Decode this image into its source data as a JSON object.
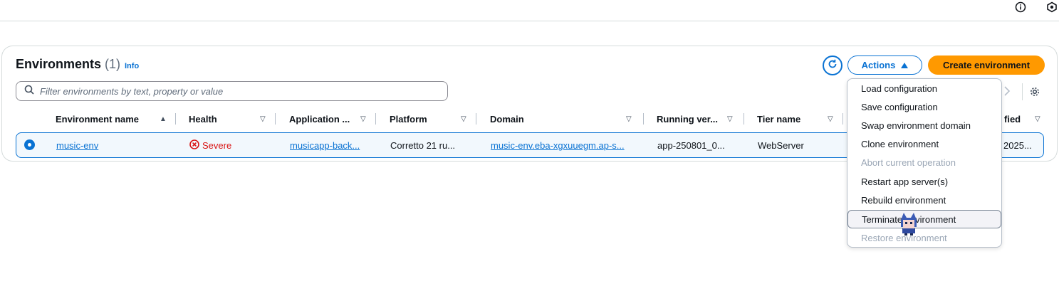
{
  "colors": {
    "accent": "#0972d3",
    "primary_button": "#ff9900",
    "severe": "#d91515",
    "selected_row_bg": "#f2f8fd",
    "disabled_text": "#9ba7b6"
  },
  "topbar": {
    "icons": [
      "info-circle-icon",
      "hexagon-icon"
    ]
  },
  "panel": {
    "title": "Environments",
    "count": "(1)",
    "info_link": "Info",
    "refresh_icon": "refresh-icon",
    "actions_label": "Actions",
    "create_label": "Create environment",
    "filter_placeholder": "Filter environments by text, property or value"
  },
  "table": {
    "columns": [
      {
        "label": "Environment name",
        "sort": "▲"
      },
      {
        "label": "Health",
        "sort": "▽"
      },
      {
        "label": "Application ...",
        "sort": "▽"
      },
      {
        "label": "Platform",
        "sort": "▽"
      },
      {
        "label": "Domain",
        "sort": "▽"
      },
      {
        "label": "Running ver...",
        "sort": "▽"
      },
      {
        "label": "Tier name",
        "sort": "▽"
      },
      {
        "label": "fied",
        "sort": "▽"
      }
    ],
    "rows": [
      {
        "selected": true,
        "environment_name": "music-env",
        "health": "Severe",
        "application": "musicapp-back...",
        "platform": "Corretto 21 ru...",
        "domain": "music-env.eba-xgxuuegm.ap-s...",
        "running_version": "app-250801_0...",
        "tier_name": "WebServer",
        "last_modified": "2025..."
      }
    ]
  },
  "actions_menu": {
    "items": [
      {
        "label": "Load configuration",
        "disabled": false
      },
      {
        "label": "Save configuration",
        "disabled": false
      },
      {
        "label": "Swap environment domain",
        "disabled": false
      },
      {
        "label": "Clone environment",
        "disabled": false
      },
      {
        "label": "Abort current operation",
        "disabled": true
      },
      {
        "label": "Restart app server(s)",
        "disabled": false
      },
      {
        "label": "Rebuild environment",
        "disabled": false
      },
      {
        "label": "Terminate environment",
        "disabled": false,
        "hovered": true
      },
      {
        "label": "Restore environment",
        "disabled": true
      }
    ]
  }
}
